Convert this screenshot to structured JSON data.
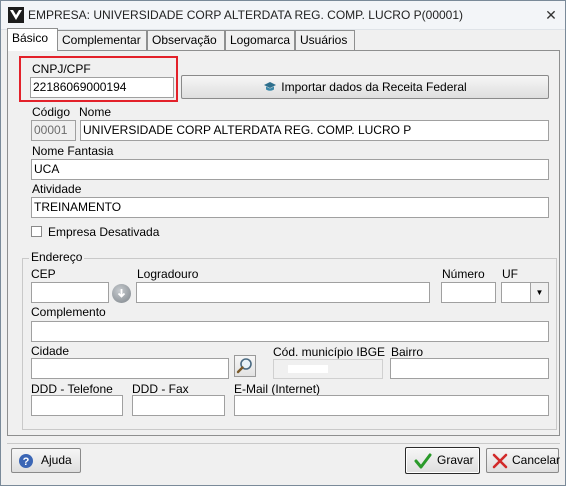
{
  "window": {
    "title": "EMPRESA: UNIVERSIDADE CORP ALTERDATA REG. COMP. LUCRO P(00001)",
    "close": "✕"
  },
  "tabs": [
    {
      "label": "Básico"
    },
    {
      "label": "Complementar"
    },
    {
      "label": "Observação"
    },
    {
      "label": "Logomarca"
    },
    {
      "label": "Usuários"
    }
  ],
  "cnpj": {
    "label": "CNPJ/CPF",
    "value": "22186069000194"
  },
  "import_button": {
    "label": "Importar dados da Receita Federal"
  },
  "codigo": {
    "label": "Código",
    "value": "00001"
  },
  "nome": {
    "label": "Nome",
    "value": "UNIVERSIDADE CORP ALTERDATA REG. COMP. LUCRO P"
  },
  "nome_fantasia": {
    "label": "Nome Fantasia",
    "value": "UCA"
  },
  "atividade": {
    "label": "Atividade",
    "value": "TREINAMENTO"
  },
  "desativada": {
    "label": "Empresa Desativada",
    "checked": false
  },
  "endereco": {
    "legend": "Endereço",
    "cep": {
      "label": "CEP",
      "value": ""
    },
    "logradouro": {
      "label": "Logradouro",
      "value": ""
    },
    "numero": {
      "label": "Número",
      "value": ""
    },
    "uf": {
      "label": "UF",
      "value": ""
    },
    "complemento": {
      "label": "Complemento",
      "value": ""
    },
    "cidade": {
      "label": "Cidade",
      "value": ""
    },
    "cod_municipio": {
      "label": "Cód. município IBGE",
      "value": ""
    },
    "bairro": {
      "label": "Bairro",
      "value": ""
    },
    "ddd_telefone": {
      "label": "DDD - Telefone",
      "value": ""
    },
    "ddd_fax": {
      "label": "DDD - Fax",
      "value": ""
    },
    "email": {
      "label": "E-Mail (Internet)",
      "value": ""
    }
  },
  "footer": {
    "help": "Ajuda",
    "save": "Gravar",
    "cancel": "Cancelar"
  },
  "colors": {
    "highlight": "#e3212a",
    "accent_check": "#2a9a2a",
    "cancel_x": "#d22b2b"
  }
}
